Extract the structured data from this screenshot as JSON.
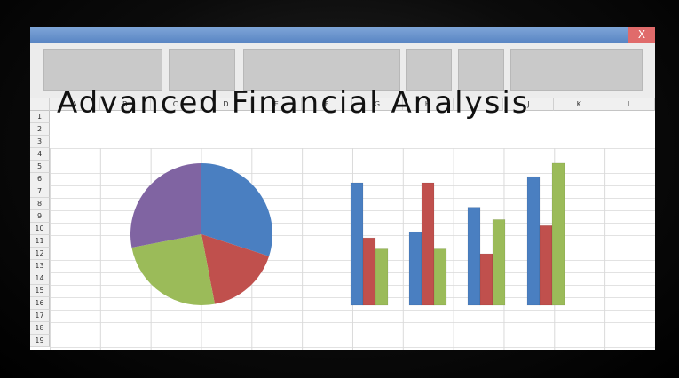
{
  "window": {
    "close_label": "X"
  },
  "spreadsheet": {
    "columns": [
      "A",
      "B",
      "C",
      "D",
      "E",
      "F",
      "G",
      "H",
      "I",
      "J",
      "K",
      "L"
    ],
    "rows": [
      "1",
      "2",
      "3",
      "4",
      "5",
      "6",
      "7",
      "8",
      "9",
      "10",
      "11",
      "12",
      "13",
      "14",
      "15",
      "16",
      "17",
      "18",
      "19"
    ],
    "title": "Advanced Financial Analysis"
  },
  "colors": {
    "blue": "#4a7fc1",
    "red": "#c0504d",
    "green": "#9bbb59",
    "purple": "#8064a2"
  },
  "chart_data": [
    {
      "type": "pie",
      "values": [
        30,
        17,
        25,
        28
      ],
      "colors": [
        "#4a7fc1",
        "#c0504d",
        "#9bbb59",
        "#8064a2"
      ]
    },
    {
      "type": "bar",
      "categories": [
        "",
        "",
        "",
        ""
      ],
      "series": [
        {
          "values": [
            10,
            6,
            8,
            10.5
          ],
          "color": "#4a7fc1"
        },
        {
          "values": [
            5.5,
            10,
            4.2,
            6.5
          ],
          "color": "#c0504d"
        },
        {
          "values": [
            4.6,
            4.6,
            7,
            11.6
          ],
          "color": "#9bbb59"
        }
      ],
      "ylim": [
        0,
        12
      ]
    }
  ]
}
